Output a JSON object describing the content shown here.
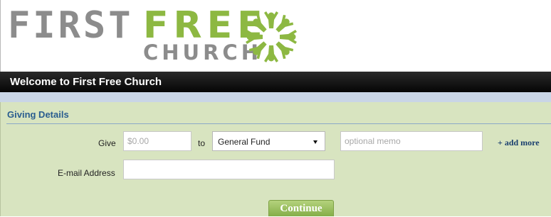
{
  "logo": {
    "word_first": "FIRST",
    "word_free": "FREE",
    "word_church": "CHURCH",
    "emblem_icon": "people-circle-emblem-icon",
    "color_gray": "#8c8c8c",
    "color_green": "#8db842"
  },
  "welcome": {
    "title": "Welcome to First Free Church"
  },
  "giving": {
    "section_title": "Giving Details",
    "give_label": "Give",
    "amount_placeholder": "$0.00",
    "amount_value": "",
    "to_label": "to",
    "fund_selected": "General Fund",
    "memo_placeholder": "optional memo",
    "memo_value": "",
    "add_more_label": "+ add more",
    "email_label": "E-mail Address",
    "email_value": "",
    "continue_label": "Continue"
  }
}
